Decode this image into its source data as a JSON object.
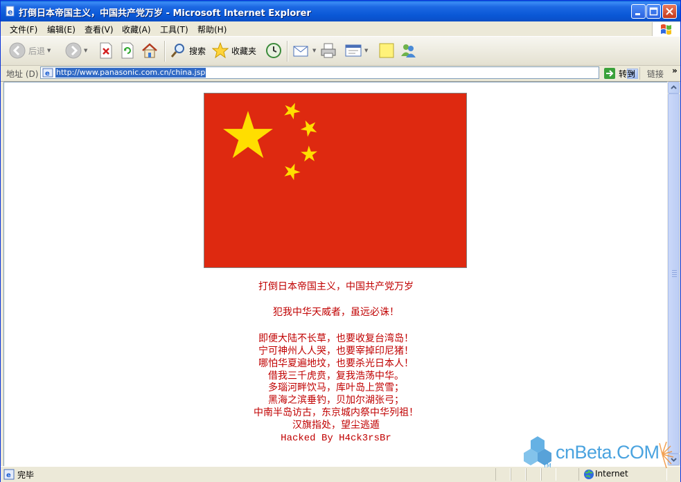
{
  "window": {
    "title": "打倒日本帝国主义，中国共产党万岁 - Microsoft Internet Explorer"
  },
  "menu": {
    "items": [
      "文件(F)",
      "编辑(E)",
      "查看(V)",
      "收藏(A)",
      "工具(T)",
      "帮助(H)"
    ]
  },
  "toolbar": {
    "back_label": "后退",
    "search_label": "搜索",
    "favorites_label": "收藏夹"
  },
  "address": {
    "label": "地址 (D)",
    "url": "http://www.panasonic.com.cn/china.jsp",
    "go_label": "转到",
    "links_label": "链接"
  },
  "page": {
    "lines": [
      "打倒日本帝国主义，中国共产党万岁",
      "犯我中华天威者，虽远必诛！",
      "即便大陆不长草，也要收复台湾岛！",
      "宁可神州人人哭，也要宰掉印尼猪！",
      "哪怕华夏遍地坟，也要杀光日本人！",
      "借我三千虎贲，复我浩荡中华。",
      "多瑙河畔饮马，库叶岛上赏雪；",
      "黑海之滨垂钓，贝加尔湖张弓；",
      "中南半岛访古，东京城内祭中华列祖！",
      "汉旗指处，望尘逃遁",
      "Hacked By H4ck3rsBr"
    ],
    "text_color": "#c00000",
    "flag_red": "#de2910",
    "flag_yellow": "#ffde00"
  },
  "status": {
    "text": "完毕",
    "zone": "Internet"
  },
  "watermark": {
    "text": "cnBeta.COM",
    "tm": "TM"
  }
}
